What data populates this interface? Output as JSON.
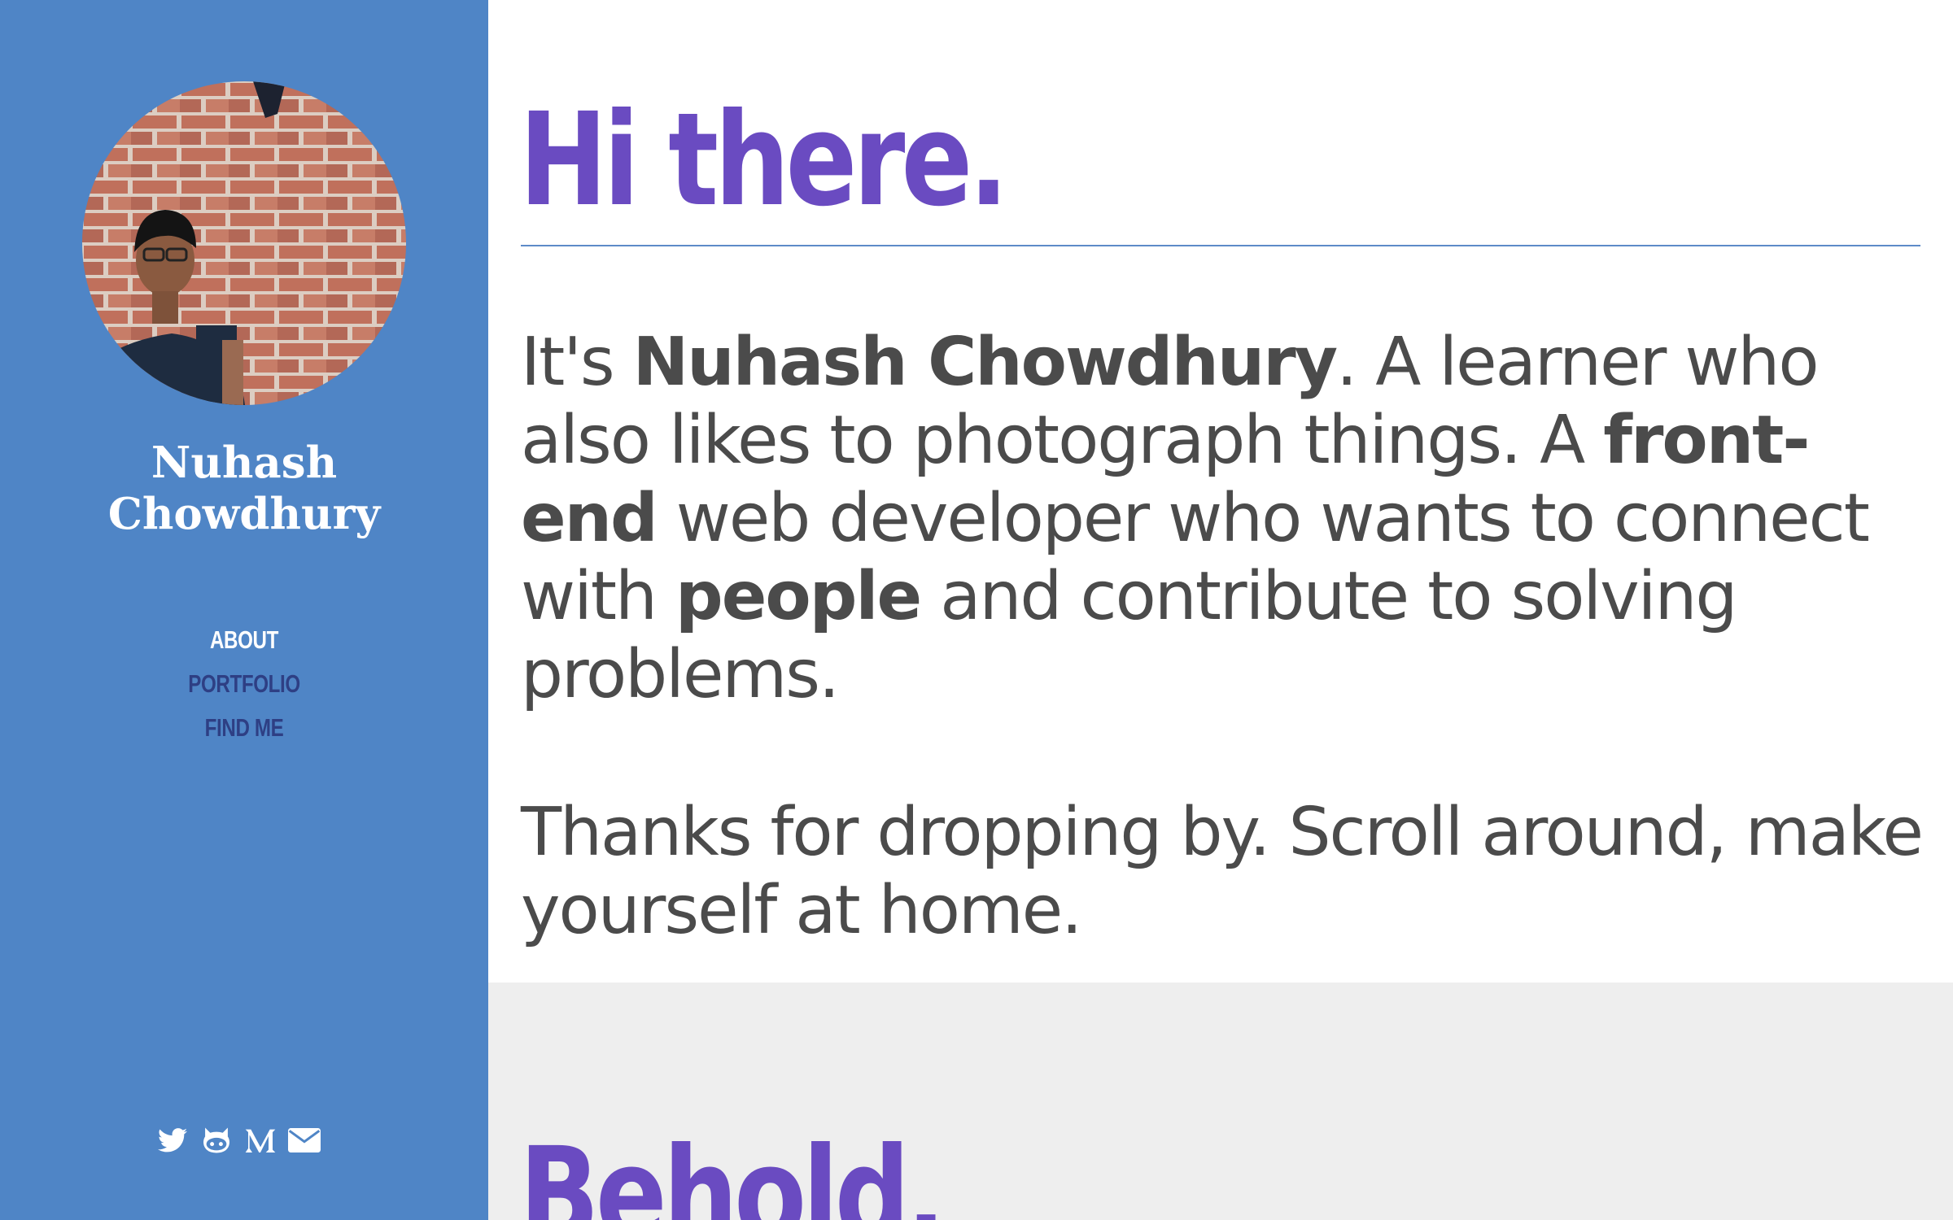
{
  "profile": {
    "name_line1": "Nuhash",
    "name_line2": "Chowdhury"
  },
  "nav": {
    "items": [
      {
        "label": "ABOUT"
      },
      {
        "label": "PORTFOLIO"
      },
      {
        "label": "FIND ME"
      }
    ]
  },
  "social": {
    "icons": [
      "twitter-icon",
      "github-icon",
      "medium-icon",
      "email-icon"
    ]
  },
  "intro": {
    "heading": "Hi there.",
    "p1": {
      "s1": "It's ",
      "b1": "Nuhash Chowdhury",
      "s2": ". A learner who also likes to photograph things. A ",
      "b2": "front-end",
      "s3": " web developer who wants to connect with ",
      "b3": "people",
      "s4": " and contribute to solving problems."
    },
    "p2": "Thanks for dropping by. Scroll around, make yourself at home."
  },
  "portfolio": {
    "heading": "Behold."
  },
  "colors": {
    "sidebar_bg": "#4f85c6",
    "heading": "#6a4bc1",
    "body_text": "#4b4b4b",
    "nav_inactive": "#2e3f84",
    "section_alt_bg": "#eeeeee"
  }
}
